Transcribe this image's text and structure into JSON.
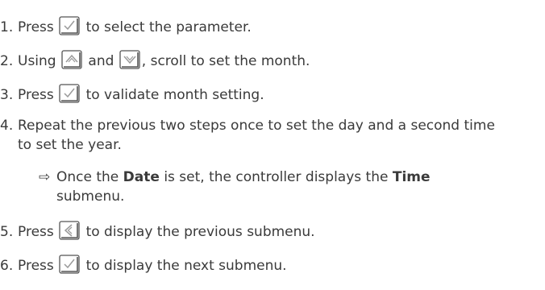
{
  "steps": [
    {
      "num": "1.",
      "pre": "Press",
      "post": "to select the parameter."
    },
    {
      "num": "2.",
      "pre": "Using",
      "mid": "and",
      "post": ", scroll to set the month."
    },
    {
      "num": "3.",
      "pre": "Press",
      "post": "to validate month setting."
    },
    {
      "num": "4.",
      "line1": "Repeat the previous two steps once to set the day and a second time",
      "line2": "to set the year.",
      "result": {
        "arrow": "⇨",
        "t1": "Once the",
        "b1": "Date",
        "t2": "is set, the controller displays the",
        "b2": "Time",
        "line2": "submenu."
      }
    },
    {
      "num": "5.",
      "pre": "Press",
      "post": "to display the previous submenu."
    },
    {
      "num": "6.",
      "pre": "Press",
      "post": "to display the next submenu."
    }
  ],
  "icons": {
    "validate": "checkmark-key-icon",
    "up": "up-arrow-key-icon",
    "down": "down-arrow-key-icon",
    "back": "left-arrow-key-icon"
  },
  "colors": {
    "text": "#3a3a3a",
    "key_border": "#555555",
    "key_symbol": "#9a9a9a"
  }
}
